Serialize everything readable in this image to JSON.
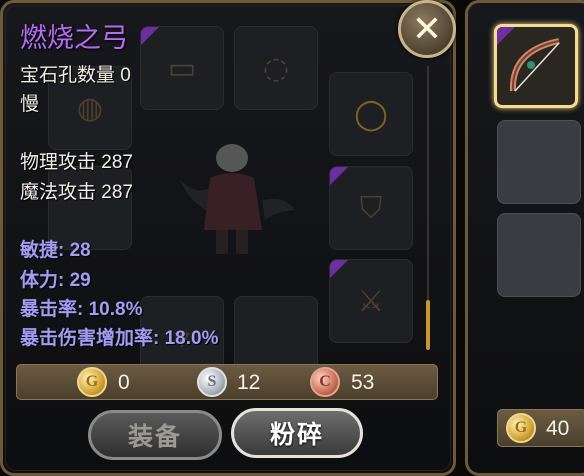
{
  "item": {
    "name": "燃烧之弓",
    "gem_slots": "宝石孔数量 0",
    "speed": "慢",
    "physical_attack": "物理攻击 287",
    "magic_attack": "魔法攻击 287",
    "bonuses": [
      "敏捷: 28",
      "体力: 29",
      "暴击率: 10.8%",
      "暴击伤害增加率: 18.0%"
    ],
    "name_color": "#b46cf4",
    "bonus_color": "#a49bf2"
  },
  "currency": {
    "gold": {
      "letter": "G",
      "value": "0"
    },
    "silver": {
      "letter": "S",
      "value": "12"
    },
    "copper": {
      "letter": "C",
      "value": "53"
    }
  },
  "buttons": {
    "equip": "装备",
    "smash": "粉碎",
    "close_icon": "✕"
  },
  "side_panel": {
    "gold_letter": "G",
    "gold_value": "40"
  },
  "icons": [
    "close-icon",
    "bow-icon",
    "gold-coin-icon",
    "silver-coin-icon",
    "copper-coin-icon"
  ]
}
